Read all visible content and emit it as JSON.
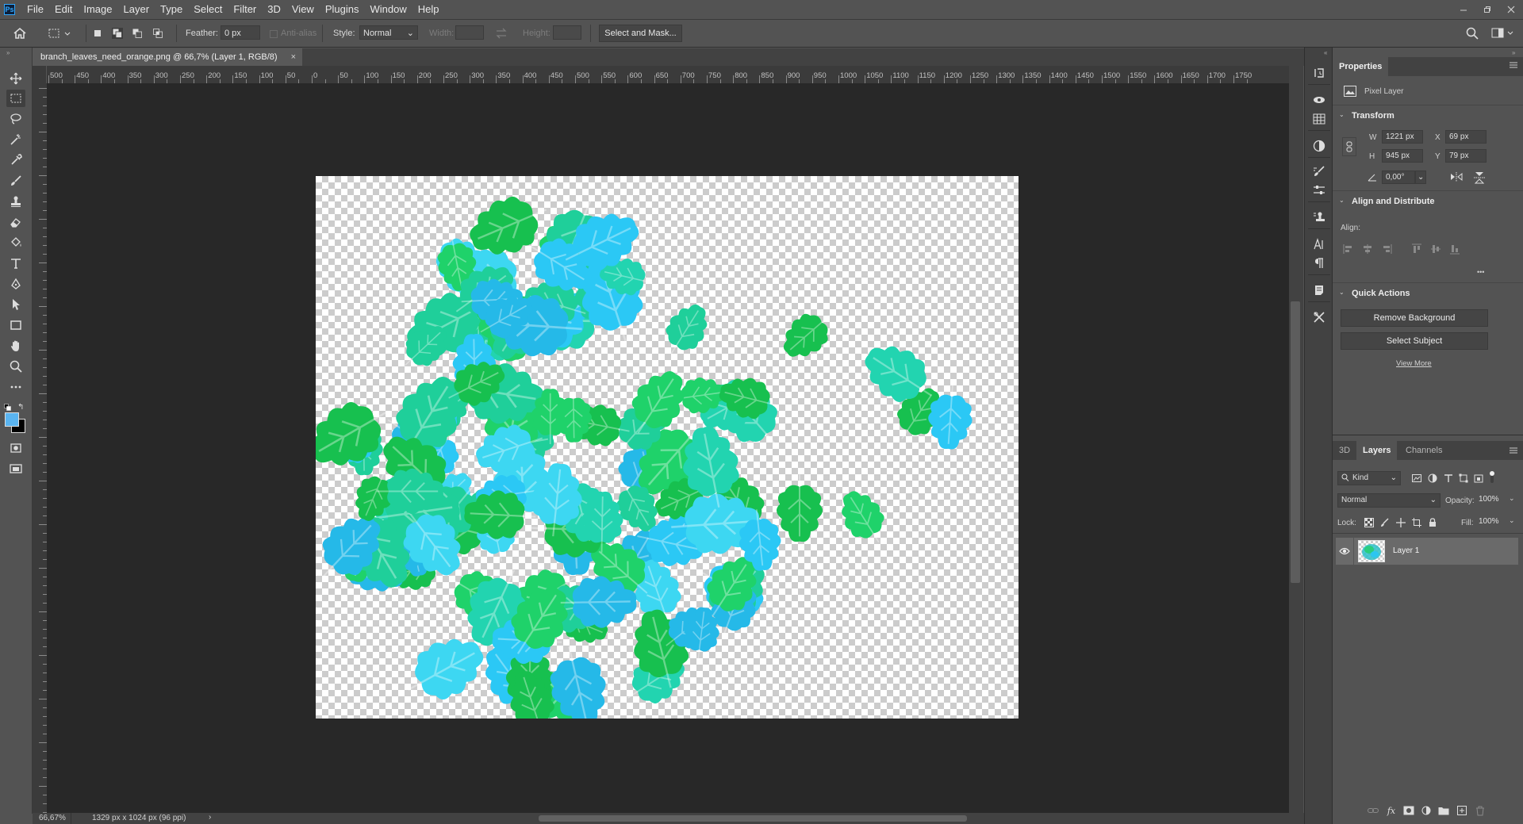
{
  "app": {
    "logo": "Ps",
    "menu": [
      "File",
      "Edit",
      "Image",
      "Layer",
      "Type",
      "Select",
      "Filter",
      "3D",
      "View",
      "Plugins",
      "Window",
      "Help"
    ],
    "window_controls": [
      "minimize-icon",
      "restore-icon",
      "close-icon"
    ]
  },
  "options_bar": {
    "feather_label": "Feather:",
    "feather_value": "0 px",
    "antialias_label": "Anti-alias",
    "style_label": "Style:",
    "style_value": "Normal",
    "width_label": "Width:",
    "height_label": "Height:",
    "select_mask_label": "Select and Mask..."
  },
  "document": {
    "tab_title": "branch_leaves_need_orange.png @ 66,7% (Layer 1, RGB/8)",
    "tab_close": "×",
    "ruler_labels": [
      "500",
      "450",
      "400",
      "350",
      "300",
      "250",
      "200",
      "150",
      "100",
      "50",
      "0",
      "50",
      "100",
      "150",
      "200",
      "250",
      "300",
      "350",
      "400",
      "450",
      "500",
      "550",
      "600",
      "650",
      "700",
      "750",
      "800",
      "850",
      "900",
      "950",
      "1000",
      "1050",
      "1100",
      "1150",
      "1200",
      "1250",
      "1300",
      "1350",
      "1400",
      "1450",
      "1500",
      "1550",
      "1600",
      "1650",
      "1700",
      "1750"
    ]
  },
  "status": {
    "zoom": "66,67%",
    "doc_info": "1329 px x 1024 px (96 ppi)",
    "arrow": "›"
  },
  "properties": {
    "tab": "Properties",
    "layer_type": "Pixel Layer",
    "transform_title": "Transform",
    "w_label": "W",
    "w_value": "1221 px",
    "h_label": "H",
    "h_value": "945 px",
    "x_label": "X",
    "x_value": "69 px",
    "y_label": "Y",
    "y_value": "79 px",
    "angle_value": "0,00°",
    "align_title": "Align and Distribute",
    "align_label": "Align:",
    "more": "•••",
    "quick_title": "Quick Actions",
    "remove_bg": "Remove Background",
    "select_subject": "Select Subject",
    "view_more": "View More"
  },
  "layers": {
    "tabs": [
      "3D",
      "Layers",
      "Channels"
    ],
    "active_tab": "Layers",
    "filter_kind": "Kind",
    "blend_mode": "Normal",
    "opacity_label": "Opacity:",
    "opacity_value": "100%",
    "lock_label": "Lock:",
    "fill_label": "Fill:",
    "fill_value": "100%",
    "items": [
      {
        "name": "Layer 1",
        "visible": true
      }
    ]
  },
  "colors": {
    "foreground": "#5ab4f0",
    "background": "#000000",
    "leaf_cyan": "#2bc8f5",
    "leaf_green": "#1fd26a"
  }
}
